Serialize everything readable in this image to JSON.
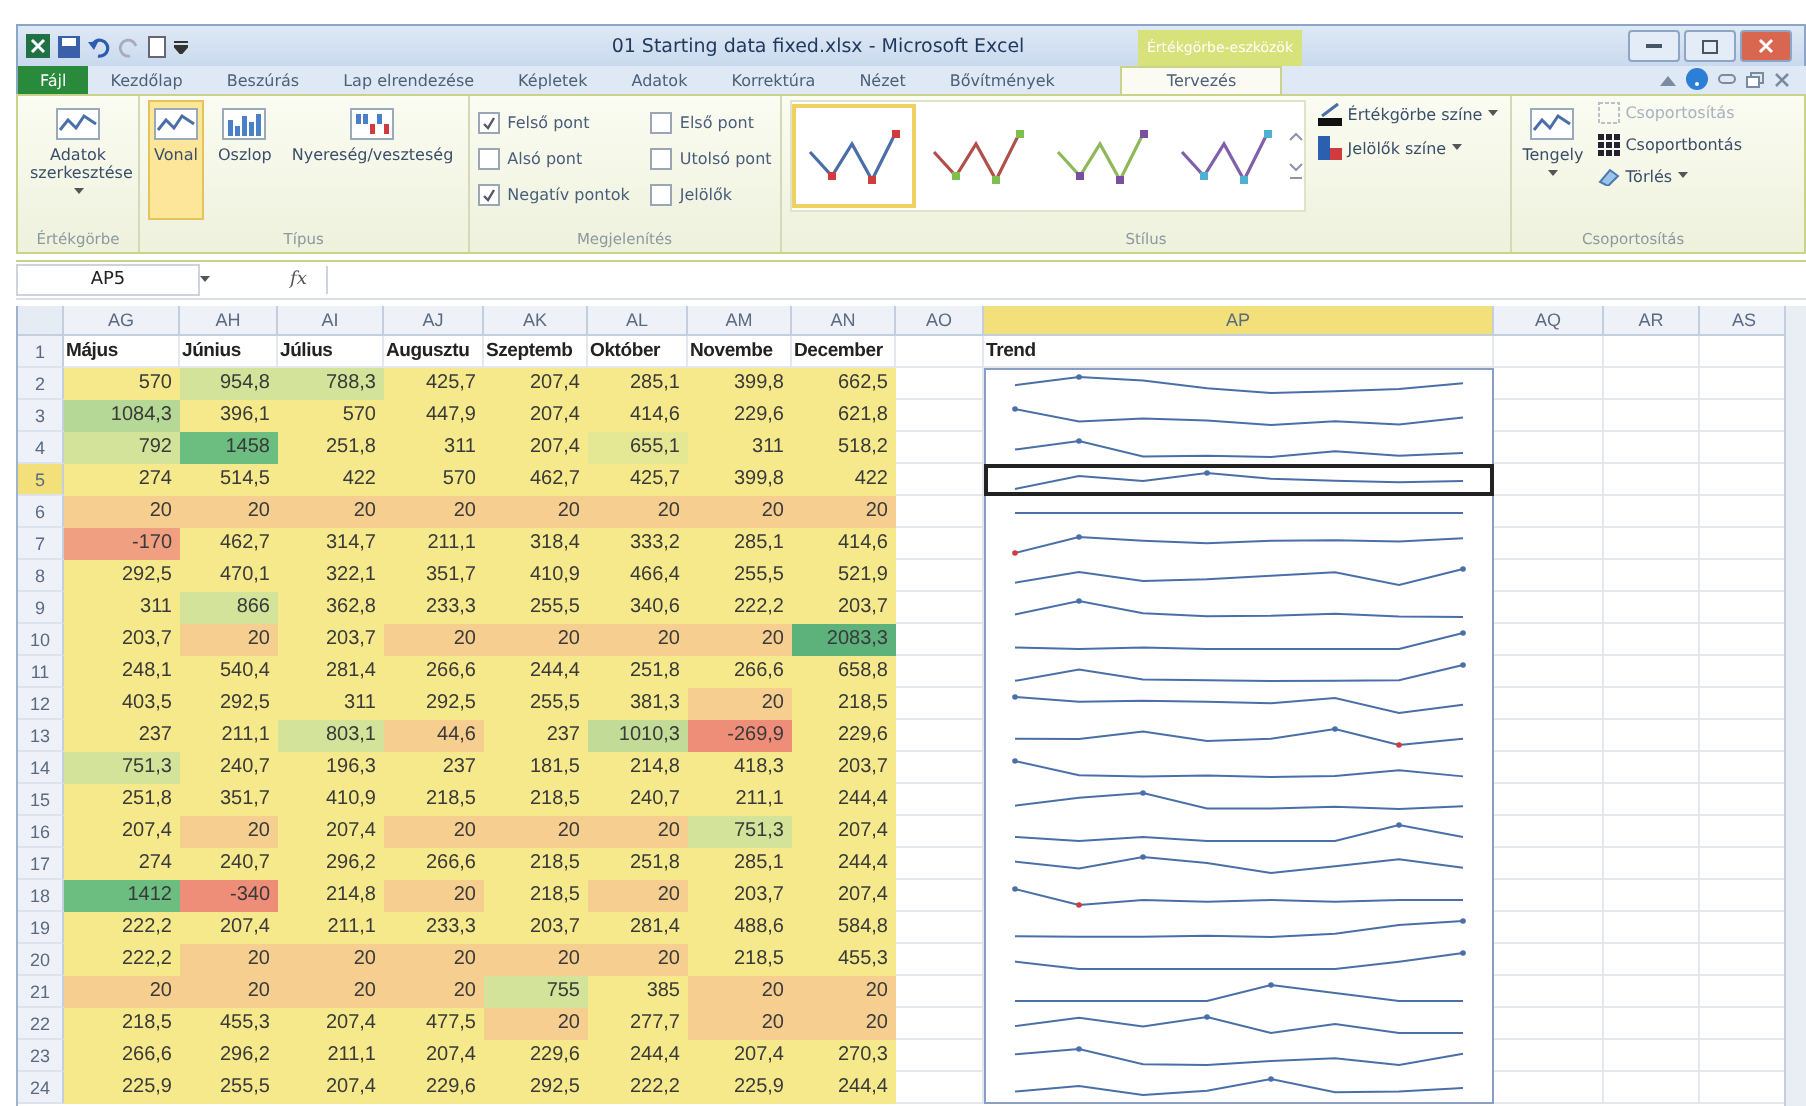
{
  "window": {
    "title": "01 Starting data fixed.xlsx - Microsoft Excel",
    "context_group": "Értékgörbe-eszközök"
  },
  "ribbon_tabs": [
    {
      "label": "Fájl",
      "kind": "file",
      "selected": false
    },
    {
      "label": "Kezdőlap",
      "kind": "normal",
      "selected": false
    },
    {
      "label": "Beszúrás",
      "kind": "normal",
      "selected": false
    },
    {
      "label": "Lap elrendezése",
      "kind": "normal",
      "selected": false
    },
    {
      "label": "Képletek",
      "kind": "normal",
      "selected": false
    },
    {
      "label": "Adatok",
      "kind": "normal",
      "selected": false
    },
    {
      "label": "Korrektúra",
      "kind": "normal",
      "selected": false
    },
    {
      "label": "Nézet",
      "kind": "normal",
      "selected": false
    },
    {
      "label": "Bővítmények",
      "kind": "normal",
      "selected": false
    },
    {
      "label": "Tervezés",
      "kind": "context",
      "selected": true
    }
  ],
  "sparkline_group": {
    "label": "Értékgörbe",
    "edit_data": "Adatok szerkesztése"
  },
  "type_group": {
    "label": "Típus",
    "types": [
      {
        "label": "Vonal",
        "kind": "line",
        "selected": true
      },
      {
        "label": "Oszlop",
        "kind": "column",
        "selected": false
      },
      {
        "label": "Nyereség/veszteség",
        "kind": "winloss",
        "selected": false
      }
    ]
  },
  "show_group": {
    "label": "Megjelenítés",
    "options": [
      {
        "label": "Felső pont",
        "kind": "high",
        "checked": true
      },
      {
        "label": "Alsó pont",
        "kind": "low",
        "checked": false
      },
      {
        "label": "Negatív pontok",
        "kind": "negative",
        "checked": true
      },
      {
        "label": "Első pont",
        "kind": "first",
        "checked": false
      },
      {
        "label": "Utolsó pont",
        "kind": "last",
        "checked": false
      },
      {
        "label": "Jelölők",
        "kind": "markers",
        "checked": false
      }
    ]
  },
  "style_group": {
    "label": "Stílus",
    "styles": [
      {
        "color": "#4a6fa8",
        "markers": {
          "color": "#d03c3c"
        },
        "selected": true
      },
      {
        "color": "#b0504a",
        "markers": {
          "color": "#7fbf4f"
        },
        "selected": false
      },
      {
        "color": "#8fb85a",
        "markers": {
          "color": "#7a4f9f"
        },
        "selected": false
      },
      {
        "color": "#8060a8",
        "markers": {
          "color": "#4fb0d0"
        },
        "selected": false
      }
    ],
    "sparkline_color": "Értékgörbe színe",
    "marker_color": "Jelölők színe"
  },
  "group_group": {
    "label": "Csoportosítás",
    "axis": "Tengely",
    "group": "Csoportosítás",
    "group_disabled": true,
    "ungroup": "Csoportbontás",
    "clear": "Törlés"
  },
  "formula_bar": {
    "name_box": "AP5",
    "fx_label": "fx"
  },
  "sheet": {
    "columns": [
      {
        "label": "AG",
        "selected": false
      },
      {
        "label": "AH",
        "selected": false
      },
      {
        "label": "AI",
        "selected": false
      },
      {
        "label": "AJ",
        "selected": false
      },
      {
        "label": "AK",
        "selected": false
      },
      {
        "label": "AL",
        "selected": false
      },
      {
        "label": "AM",
        "selected": false
      },
      {
        "label": "AN",
        "selected": false
      },
      {
        "label": "AO",
        "selected": false
      },
      {
        "label": "AP",
        "selected": true
      },
      {
        "label": "AQ",
        "selected": false
      },
      {
        "label": "AR",
        "selected": false
      },
      {
        "label": "AS",
        "selected": false
      }
    ],
    "header_row": {
      "number": "1",
      "headers": [
        "Május",
        "Június",
        "Július",
        "Augusztu",
        "Szeptemb",
        "Október",
        "Novembe",
        "December"
      ],
      "trend": "Trend"
    },
    "rows": [
      {
        "number": "2",
        "selected": false,
        "cells": [
          {
            "value": "570",
            "color": "#f6e98c"
          },
          {
            "value": "954,8",
            "color": "#d3e39a"
          },
          {
            "value": "788,3",
            "color": "#d3e39a"
          },
          {
            "value": "425,7",
            "color": "#f6e98c"
          },
          {
            "value": "207,4",
            "color": "#f6e98c"
          },
          {
            "value": "285,1",
            "color": "#f6e98c"
          },
          {
            "value": "399,8",
            "color": "#f6e98c"
          },
          {
            "value": "662,5",
            "color": "#f6e98c"
          }
        ]
      },
      {
        "number": "3",
        "selected": false,
        "cells": [
          {
            "value": "1084,3",
            "color": "#b5d896"
          },
          {
            "value": "396,1",
            "color": "#f6e98c"
          },
          {
            "value": "570",
            "color": "#f6e98c"
          },
          {
            "value": "447,9",
            "color": "#f6e98c"
          },
          {
            "value": "207,4",
            "color": "#f6e98c"
          },
          {
            "value": "414,6",
            "color": "#f6e98c"
          },
          {
            "value": "229,6",
            "color": "#f6e98c"
          },
          {
            "value": "621,8",
            "color": "#f6e98c"
          }
        ]
      },
      {
        "number": "4",
        "selected": false,
        "cells": [
          {
            "value": "792",
            "color": "#d3e39a"
          },
          {
            "value": "1458",
            "color": "#6cbd80"
          },
          {
            "value": "251,8",
            "color": "#f6e98c"
          },
          {
            "value": "311",
            "color": "#f6e98c"
          },
          {
            "value": "207,4",
            "color": "#f6e98c"
          },
          {
            "value": "655,1",
            "color": "#e4e894"
          },
          {
            "value": "311",
            "color": "#f6e98c"
          },
          {
            "value": "518,2",
            "color": "#f6e98c"
          }
        ]
      },
      {
        "number": "5",
        "selected": true,
        "cells": [
          {
            "value": "274",
            "color": "#f6e98c"
          },
          {
            "value": "514,5",
            "color": "#f6e98c"
          },
          {
            "value": "422",
            "color": "#f6e98c"
          },
          {
            "value": "570",
            "color": "#f6e98c"
          },
          {
            "value": "462,7",
            "color": "#f6e98c"
          },
          {
            "value": "425,7",
            "color": "#f6e98c"
          },
          {
            "value": "399,8",
            "color": "#f6e98c"
          },
          {
            "value": "422",
            "color": "#f6e98c"
          }
        ]
      },
      {
        "number": "6",
        "selected": false,
        "cells": [
          {
            "value": "20",
            "color": "#f6cf90"
          },
          {
            "value": "20",
            "color": "#f6cf90"
          },
          {
            "value": "20",
            "color": "#f6cf90"
          },
          {
            "value": "20",
            "color": "#f6cf90"
          },
          {
            "value": "20",
            "color": "#f6cf90"
          },
          {
            "value": "20",
            "color": "#f6cf90"
          },
          {
            "value": "20",
            "color": "#f6cf90"
          },
          {
            "value": "20",
            "color": "#f6cf90"
          }
        ]
      },
      {
        "number": "7",
        "selected": false,
        "cells": [
          {
            "value": "-170",
            "color": "#f0a080"
          },
          {
            "value": "462,7",
            "color": "#f6e98c"
          },
          {
            "value": "314,7",
            "color": "#f6e98c"
          },
          {
            "value": "211,1",
            "color": "#f6e98c"
          },
          {
            "value": "318,4",
            "color": "#f6e98c"
          },
          {
            "value": "333,2",
            "color": "#f6e98c"
          },
          {
            "value": "285,1",
            "color": "#f6e98c"
          },
          {
            "value": "414,6",
            "color": "#f6e98c"
          }
        ]
      },
      {
        "number": "8",
        "selected": false,
        "cells": [
          {
            "value": "292,5",
            "color": "#f6e98c"
          },
          {
            "value": "470,1",
            "color": "#f6e98c"
          },
          {
            "value": "322,1",
            "color": "#f6e98c"
          },
          {
            "value": "351,7",
            "color": "#f6e98c"
          },
          {
            "value": "410,9",
            "color": "#f6e98c"
          },
          {
            "value": "466,4",
            "color": "#f6e98c"
          },
          {
            "value": "255,5",
            "color": "#f6e98c"
          },
          {
            "value": "521,9",
            "color": "#f6e98c"
          }
        ]
      },
      {
        "number": "9",
        "selected": false,
        "cells": [
          {
            "value": "311",
            "color": "#f6e98c"
          },
          {
            "value": "866",
            "color": "#d3e39a"
          },
          {
            "value": "362,8",
            "color": "#f6e98c"
          },
          {
            "value": "233,3",
            "color": "#f6e98c"
          },
          {
            "value": "255,5",
            "color": "#f6e98c"
          },
          {
            "value": "340,6",
            "color": "#f6e98c"
          },
          {
            "value": "222,2",
            "color": "#f6e98c"
          },
          {
            "value": "203,7",
            "color": "#f6e98c"
          }
        ]
      },
      {
        "number": "10",
        "selected": false,
        "cells": [
          {
            "value": "203,7",
            "color": "#f6e98c"
          },
          {
            "value": "20",
            "color": "#f6cf90"
          },
          {
            "value": "203,7",
            "color": "#f6e98c"
          },
          {
            "value": "20",
            "color": "#f6cf90"
          },
          {
            "value": "20",
            "color": "#f6cf90"
          },
          {
            "value": "20",
            "color": "#f6cf90"
          },
          {
            "value": "20",
            "color": "#f6cf90"
          },
          {
            "value": "2083,3",
            "color": "#5cb27a"
          }
        ]
      },
      {
        "number": "11",
        "selected": false,
        "cells": [
          {
            "value": "248,1",
            "color": "#f6e98c"
          },
          {
            "value": "540,4",
            "color": "#f6e98c"
          },
          {
            "value": "281,4",
            "color": "#f6e98c"
          },
          {
            "value": "266,6",
            "color": "#f6e98c"
          },
          {
            "value": "244,4",
            "color": "#f6e98c"
          },
          {
            "value": "251,8",
            "color": "#f6e98c"
          },
          {
            "value": "266,6",
            "color": "#f6e98c"
          },
          {
            "value": "658,8",
            "color": "#f6e98c"
          }
        ]
      },
      {
        "number": "12",
        "selected": false,
        "cells": [
          {
            "value": "403,5",
            "color": "#f6e98c"
          },
          {
            "value": "292,5",
            "color": "#f6e98c"
          },
          {
            "value": "311",
            "color": "#f6e98c"
          },
          {
            "value": "292,5",
            "color": "#f6e98c"
          },
          {
            "value": "255,5",
            "color": "#f6e98c"
          },
          {
            "value": "381,3",
            "color": "#f6e98c"
          },
          {
            "value": "20",
            "color": "#f6cf90"
          },
          {
            "value": "218,5",
            "color": "#f6e98c"
          }
        ]
      },
      {
        "number": "13",
        "selected": false,
        "cells": [
          {
            "value": "237",
            "color": "#f6e98c"
          },
          {
            "value": "211,1",
            "color": "#f6e98c"
          },
          {
            "value": "803,1",
            "color": "#d3e39a"
          },
          {
            "value": "44,6",
            "color": "#f6cf90"
          },
          {
            "value": "237",
            "color": "#f6e98c"
          },
          {
            "value": "1010,3",
            "color": "#c2dc98"
          },
          {
            "value": "-269,9",
            "color": "#ee8e78"
          },
          {
            "value": "229,6",
            "color": "#f6e98c"
          }
        ]
      },
      {
        "number": "14",
        "selected": false,
        "cells": [
          {
            "value": "751,3",
            "color": "#d3e39a"
          },
          {
            "value": "240,7",
            "color": "#f6e98c"
          },
          {
            "value": "196,3",
            "color": "#f6e98c"
          },
          {
            "value": "237",
            "color": "#f6e98c"
          },
          {
            "value": "181,5",
            "color": "#f6e98c"
          },
          {
            "value": "214,8",
            "color": "#f6e98c"
          },
          {
            "value": "418,3",
            "color": "#f6e98c"
          },
          {
            "value": "203,7",
            "color": "#f6e98c"
          }
        ]
      },
      {
        "number": "15",
        "selected": false,
        "cells": [
          {
            "value": "251,8",
            "color": "#f6e98c"
          },
          {
            "value": "351,7",
            "color": "#f6e98c"
          },
          {
            "value": "410,9",
            "color": "#f6e98c"
          },
          {
            "value": "218,5",
            "color": "#f6e98c"
          },
          {
            "value": "218,5",
            "color": "#f6e98c"
          },
          {
            "value": "240,7",
            "color": "#f6e98c"
          },
          {
            "value": "211,1",
            "color": "#f6e98c"
          },
          {
            "value": "244,4",
            "color": "#f6e98c"
          }
        ]
      },
      {
        "number": "16",
        "selected": false,
        "cells": [
          {
            "value": "207,4",
            "color": "#f6e98c"
          },
          {
            "value": "20",
            "color": "#f6cf90"
          },
          {
            "value": "207,4",
            "color": "#f6e98c"
          },
          {
            "value": "20",
            "color": "#f6cf90"
          },
          {
            "value": "20",
            "color": "#f6cf90"
          },
          {
            "value": "20",
            "color": "#f6cf90"
          },
          {
            "value": "751,3",
            "color": "#d3e39a"
          },
          {
            "value": "207,4",
            "color": "#f6e98c"
          }
        ]
      },
      {
        "number": "17",
        "selected": false,
        "cells": [
          {
            "value": "274",
            "color": "#f6e98c"
          },
          {
            "value": "240,7",
            "color": "#f6e98c"
          },
          {
            "value": "296,2",
            "color": "#f6e98c"
          },
          {
            "value": "266,6",
            "color": "#f6e98c"
          },
          {
            "value": "218,5",
            "color": "#f6e98c"
          },
          {
            "value": "251,8",
            "color": "#f6e98c"
          },
          {
            "value": "285,1",
            "color": "#f6e98c"
          },
          {
            "value": "244,4",
            "color": "#f6e98c"
          }
        ]
      },
      {
        "number": "18",
        "selected": false,
        "cells": [
          {
            "value": "1412",
            "color": "#6cbd80"
          },
          {
            "value": "-340",
            "color": "#ee8e78"
          },
          {
            "value": "214,8",
            "color": "#f6e98c"
          },
          {
            "value": "20",
            "color": "#f6cf90"
          },
          {
            "value": "218,5",
            "color": "#f6e98c"
          },
          {
            "value": "20",
            "color": "#f6cf90"
          },
          {
            "value": "203,7",
            "color": "#f6e98c"
          },
          {
            "value": "207,4",
            "color": "#f6e98c"
          }
        ]
      },
      {
        "number": "19",
        "selected": false,
        "cells": [
          {
            "value": "222,2",
            "color": "#f6e98c"
          },
          {
            "value": "207,4",
            "color": "#f6e98c"
          },
          {
            "value": "211,1",
            "color": "#f6e98c"
          },
          {
            "value": "233,3",
            "color": "#f6e98c"
          },
          {
            "value": "203,7",
            "color": "#f6e98c"
          },
          {
            "value": "281,4",
            "color": "#f6e98c"
          },
          {
            "value": "488,6",
            "color": "#f6e98c"
          },
          {
            "value": "584,8",
            "color": "#f6e98c"
          }
        ]
      },
      {
        "number": "20",
        "selected": false,
        "cells": [
          {
            "value": "222,2",
            "color": "#f6e98c"
          },
          {
            "value": "20",
            "color": "#f6cf90"
          },
          {
            "value": "20",
            "color": "#f6cf90"
          },
          {
            "value": "20",
            "color": "#f6cf90"
          },
          {
            "value": "20",
            "color": "#f6cf90"
          },
          {
            "value": "20",
            "color": "#f6cf90"
          },
          {
            "value": "218,5",
            "color": "#f6e98c"
          },
          {
            "value": "455,3",
            "color": "#f6e98c"
          }
        ]
      },
      {
        "number": "21",
        "selected": false,
        "cells": [
          {
            "value": "20",
            "color": "#f6cf90"
          },
          {
            "value": "20",
            "color": "#f6cf90"
          },
          {
            "value": "20",
            "color": "#f6cf90"
          },
          {
            "value": "20",
            "color": "#f6cf90"
          },
          {
            "value": "755",
            "color": "#d3e39a"
          },
          {
            "value": "385",
            "color": "#f6e98c"
          },
          {
            "value": "20",
            "color": "#f6cf90"
          },
          {
            "value": "20",
            "color": "#f6cf90"
          }
        ]
      },
      {
        "number": "22",
        "selected": false,
        "cells": [
          {
            "value": "218,5",
            "color": "#f6e98c"
          },
          {
            "value": "455,3",
            "color": "#f6e98c"
          },
          {
            "value": "207,4",
            "color": "#f6e98c"
          },
          {
            "value": "477,5",
            "color": "#f6e98c"
          },
          {
            "value": "20",
            "color": "#f6cf90"
          },
          {
            "value": "277,7",
            "color": "#f6e98c"
          },
          {
            "value": "20",
            "color": "#f6cf90"
          },
          {
            "value": "20",
            "color": "#f6cf90"
          }
        ]
      },
      {
        "number": "23",
        "selected": false,
        "cells": [
          {
            "value": "266,6",
            "color": "#f6e98c"
          },
          {
            "value": "296,2",
            "color": "#f6e98c"
          },
          {
            "value": "211,1",
            "color": "#f6e98c"
          },
          {
            "value": "207,4",
            "color": "#f6e98c"
          },
          {
            "value": "229,6",
            "color": "#f6e98c"
          },
          {
            "value": "244,4",
            "color": "#f6e98c"
          },
          {
            "value": "207,4",
            "color": "#f6e98c"
          },
          {
            "value": "270,3",
            "color": "#f6e98c"
          }
        ]
      },
      {
        "number": "24",
        "selected": false,
        "cells": [
          {
            "value": "225,9",
            "color": "#f6e98c"
          },
          {
            "value": "255,5",
            "color": "#f6e98c"
          },
          {
            "value": "207,4",
            "color": "#f6e98c"
          },
          {
            "value": "229,6",
            "color": "#f6e98c"
          },
          {
            "value": "292,5",
            "color": "#f6e98c"
          },
          {
            "value": "222,2",
            "color": "#f6e98c"
          },
          {
            "value": "225,9",
            "color": "#f6e98c"
          },
          {
            "value": "244,4",
            "color": "#f6e98c"
          }
        ]
      }
    ]
  }
}
